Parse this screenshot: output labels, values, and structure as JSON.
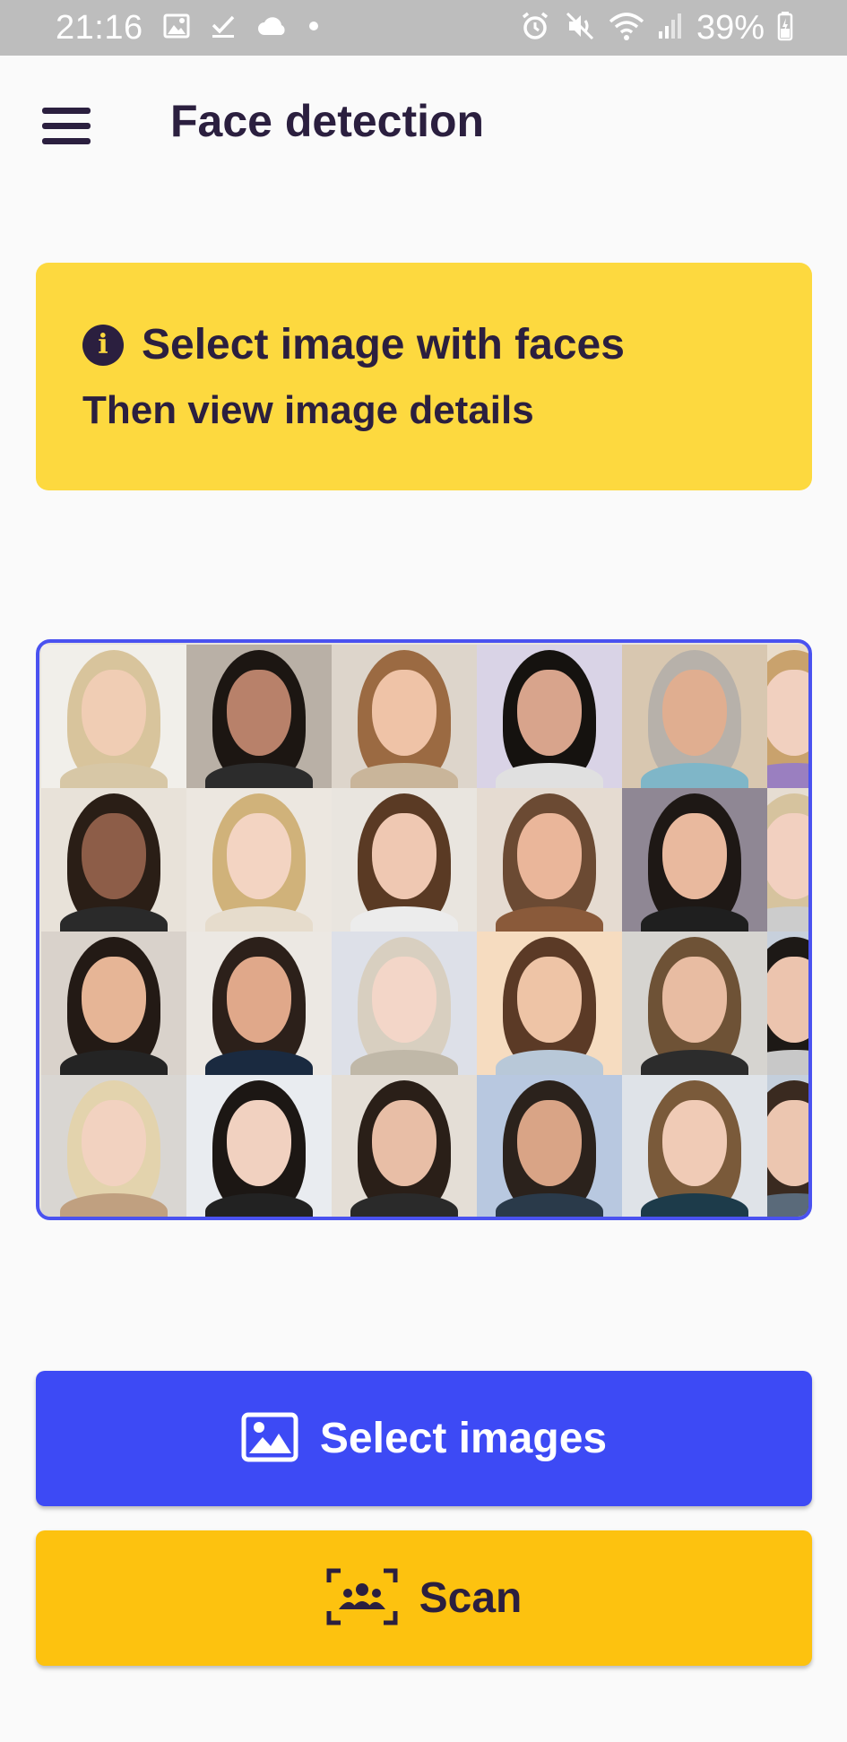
{
  "status_bar": {
    "time": "21:16",
    "battery": "39%",
    "left_icons": [
      "image-icon",
      "check-icon",
      "cloud-icon",
      "dot-icon"
    ],
    "right_icons": [
      "alarm-icon",
      "mute-icon",
      "wifi-icon",
      "signal-icon",
      "battery-icon"
    ]
  },
  "app_bar": {
    "title": "Face detection",
    "menu_icon": "hamburger-menu-icon"
  },
  "info_card": {
    "icon": "info-icon",
    "title": "Select image with faces",
    "subtitle": "Then view image details",
    "background_color": "#fdd93f"
  },
  "preview": {
    "description_icon": "face-grid-image",
    "border_color": "#4a52f0"
  },
  "buttons": {
    "select_images": {
      "label": "Select images",
      "icon": "image-icon",
      "color": "#3d4af5"
    },
    "scan": {
      "label": "Scan",
      "icon": "face-scan-icon",
      "color": "#fdc20f"
    }
  },
  "colors": {
    "text_dark": "#2b1f3f",
    "status_bar": "#bdbdbd",
    "background": "#fafafa"
  }
}
